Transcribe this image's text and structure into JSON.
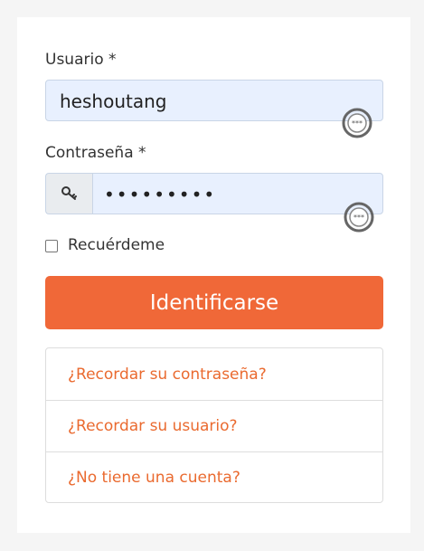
{
  "form": {
    "username_label": "Usuario *",
    "username_value": "heshoutang",
    "password_label": "Contraseña *",
    "password_value": "•••••••••",
    "remember_label": "Recuérdeme",
    "remember_checked": false,
    "submit_label": "Identificarse"
  },
  "links": [
    {
      "label": "¿Recordar su contraseña?"
    },
    {
      "label": "¿Recordar su usuario?"
    },
    {
      "label": "¿No tiene una cuenta?"
    }
  ],
  "colors": {
    "accent": "#f06838",
    "link": "#ea6a2f",
    "autofill_bg": "#e8f0fe"
  },
  "icons": {
    "password_addon": "key-icon",
    "password_manager": "password-manager-icon"
  }
}
